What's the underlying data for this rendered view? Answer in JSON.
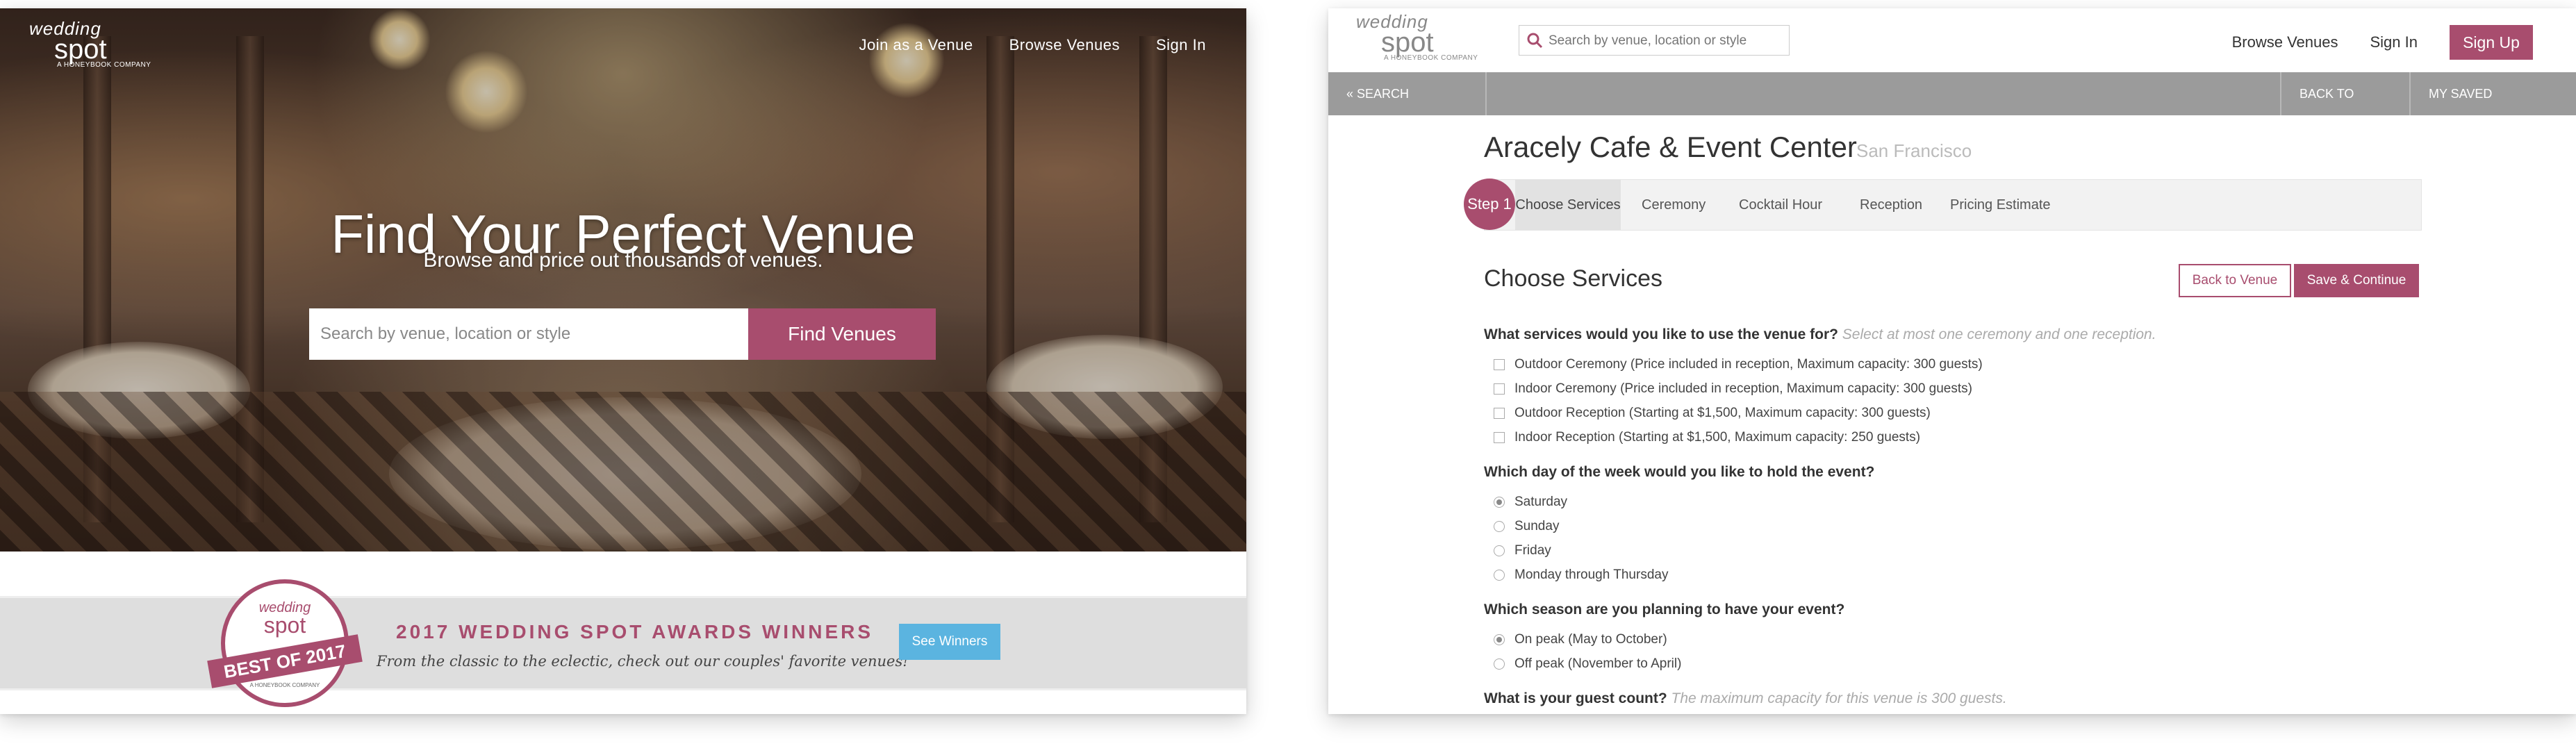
{
  "landing": {
    "logo": {
      "line1": "wedding",
      "line2": "spot",
      "line3": "A HONEYBOOK COMPANY"
    },
    "nav": [
      "Join as a Venue",
      "Browse Venues",
      "Sign In"
    ],
    "hero_title": "Find Your Perfect Venue",
    "hero_subtitle": "Browse and price out thousands of venues.",
    "search_placeholder": "Search by venue, location or style",
    "find_button": "Find Venues",
    "badge": {
      "line1": "wedding",
      "line2": "spot",
      "ribbon": "BEST OF 2017",
      "small": "A HONEYBOOK COMPANY"
    },
    "awards_title": "2017 WEDDING SPOT AWARDS WINNERS",
    "awards_subtitle": "From the classic to the eclectic, check out our couples' favorite venues!",
    "see_winners": "See Winners"
  },
  "venue_page": {
    "logo": {
      "line1": "wedding",
      "line2": "spot",
      "line3": "A HONEYBOOK COMPANY"
    },
    "search_placeholder": "Search by venue, location or style",
    "nav": {
      "browse": "Browse Venues",
      "sign_in": "Sign In",
      "sign_up": "Sign Up"
    },
    "bar": {
      "search_results": "« SEARCH RESULTS",
      "back_to_venue": "BACK TO VENUE",
      "saved_estimates": "MY SAVED ESTIMATES"
    },
    "venue_name": "Aracely Cafe & Event Center",
    "venue_city": "San Francisco",
    "step_label": "Step 1",
    "steps": [
      "Choose Services",
      "Ceremony",
      "Cocktail Hour",
      "Reception",
      "Pricing Estimate"
    ],
    "section_title": "Choose Services",
    "back_button": "Back to Venue",
    "save_button": "Save & Continue",
    "q1": {
      "text": "What services would you like to use the venue for?",
      "hint": "Select at most one ceremony and one reception."
    },
    "services": [
      "Outdoor Ceremony (Price included in reception, Maximum capacity: 300 guests)",
      "Indoor Ceremony (Price included in reception, Maximum capacity: 300 guests)",
      "Outdoor Reception (Starting at $1,500, Maximum capacity: 300 guests)",
      "Indoor Reception (Starting at $1,500, Maximum capacity: 250 guests)"
    ],
    "q2": {
      "text": "Which day of the week would you like to hold the event?"
    },
    "days": [
      "Saturday",
      "Sunday",
      "Friday",
      "Monday through Thursday"
    ],
    "q3": {
      "text": "Which season are you planning to have your event?"
    },
    "seasons": [
      "On peak (May to October)",
      "Off peak (November to April)"
    ],
    "q4": {
      "text": "What is your guest count?",
      "hint": "The maximum capacity for this venue is 300 guests."
    }
  },
  "colors": {
    "brand": "#a84d6e",
    "accent_blue": "#5bb4e0",
    "bar_gray": "#9b9b9b"
  }
}
